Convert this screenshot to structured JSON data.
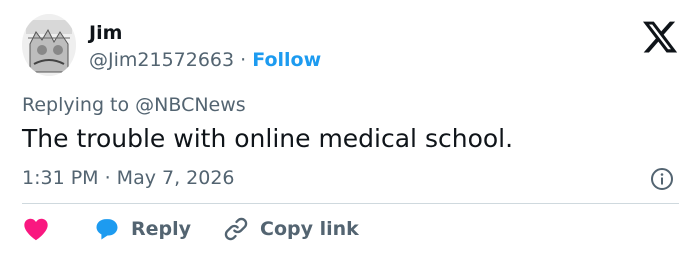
{
  "author": {
    "display_name": "Jim",
    "handle": "@Jim21572663",
    "separator": "·",
    "follow_label": "Follow"
  },
  "reply_context": {
    "prefix": "Replying to ",
    "mention": "@NBCNews"
  },
  "tweet": {
    "text": "The trouble with online medical school.",
    "timestamp": "1:31 PM · May 7, 2026"
  },
  "actions": {
    "reply_label": "Reply",
    "copy_link_label": "Copy link"
  },
  "icons": {
    "logo": "x-logo-icon",
    "info": "info-icon",
    "like": "heart-icon",
    "reply": "speech-bubble-icon",
    "copy": "link-icon"
  },
  "colors": {
    "text_primary": "#0f1419",
    "text_secondary": "#536471",
    "accent_blue": "#1d9bf0",
    "like_pink": "#f91880",
    "divider": "#cfd9de"
  }
}
